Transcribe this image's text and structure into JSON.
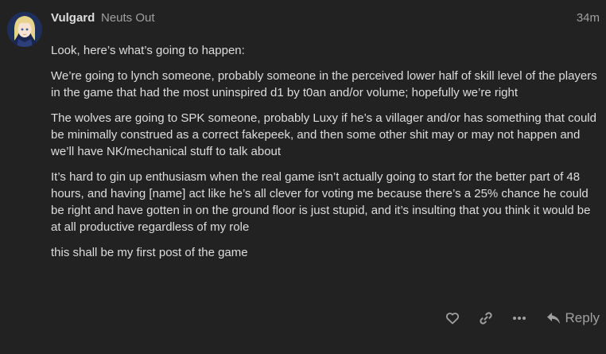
{
  "post": {
    "username": "Vulgard",
    "user_title": "Neuts Out",
    "time": "34m",
    "paragraphs": [
      "Look, here’s what’s going to happen:",
      "We’re going to lynch someone, probably someone in the perceived lower half of skill level of the players in the game that had the most uninspired d1 by t0an and/or volume; hopefully we’re right",
      "The wolves are going to SPK someone, probably Luxy if he’s a villager and/or has something that could be minimally construed as a correct fakepeek, and then some other shit may or may not happen and we’ll have NK/mechanical stuff to talk about",
      "It’s hard to gin up enthusiasm when the real game isn’t actually going to start for the better part of 48 hours, and having [name] act like he’s all clever for voting me because there’s a 25% chance he could be right and have gotten in on the ground floor is just stupid, and it’s insulting that you think it would be at all productive regardless of my role",
      "this shall be my first post of the game"
    ]
  },
  "actions": {
    "like_icon": "heart-icon",
    "link_icon": "link-icon",
    "more_icon": "ellipsis-icon",
    "reply_icon": "reply-arrow-icon",
    "reply_label": "Reply"
  },
  "colors": {
    "background": "#222222",
    "text": "#dddddd",
    "muted": "#a0a0a0"
  }
}
